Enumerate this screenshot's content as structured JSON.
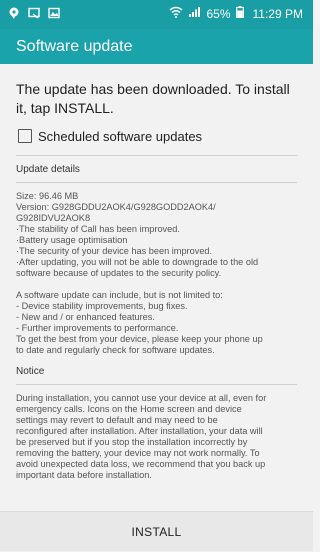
{
  "status_bar": {
    "battery_percent": "65%",
    "time": "11:29 PM",
    "icons": [
      "notification-bubble-icon",
      "cast-icon",
      "gallery-icon",
      "wifi-icon",
      "signal-icon",
      "battery-icon"
    ]
  },
  "app_bar": {
    "title": "Software update"
  },
  "main": {
    "headline": "The update has been downloaded. To install it, tap INSTALL.",
    "scheduled_checkbox": {
      "label": "Scheduled software updates",
      "checked": false
    },
    "update_details": {
      "title": "Update details",
      "lines": [
        "Size: 96.46 MB",
        "Version: G928GDDU2AOK4/G928GODD2AOK4/",
        "G928IDVU2AOK8",
        "·The stability of Call has been improved.",
        "·Battery usage optimisation",
        "·The security of your device has been improved.",
        "·After updating, you will not be able to downgrade to the old",
        "software because of updates to the security policy."
      ],
      "lines2": [
        "A software update can include, but is not limited to:",
        " - Device stability improvements, bug fixes.",
        " - New and / or enhanced features.",
        " - Further improvements to performance.",
        "To get the best from your device, please keep your phone up",
        "to date and regularly check for software updates."
      ]
    },
    "notice": {
      "title": "Notice",
      "lines": [
        "During installation, you cannot use your device at all, even for",
        "emergency calls. Icons on the Home screen and device",
        "settings may revert to default and may need to be",
        "reconfigured after installation. After installation, your data will",
        "be preserved but if you stop the installation incorrectly by",
        "removing the battery, your device may not work normally. To",
        "avoid unexpected data loss, we recommend that you back up",
        "important data before installation."
      ]
    }
  },
  "bottom": {
    "install_label": "INSTALL"
  },
  "colors": {
    "status_bar": "#1a9ea6",
    "app_bar": "#1aa3ab",
    "background": "#f2f2f2",
    "bottom_bar": "#e8e8e8"
  }
}
